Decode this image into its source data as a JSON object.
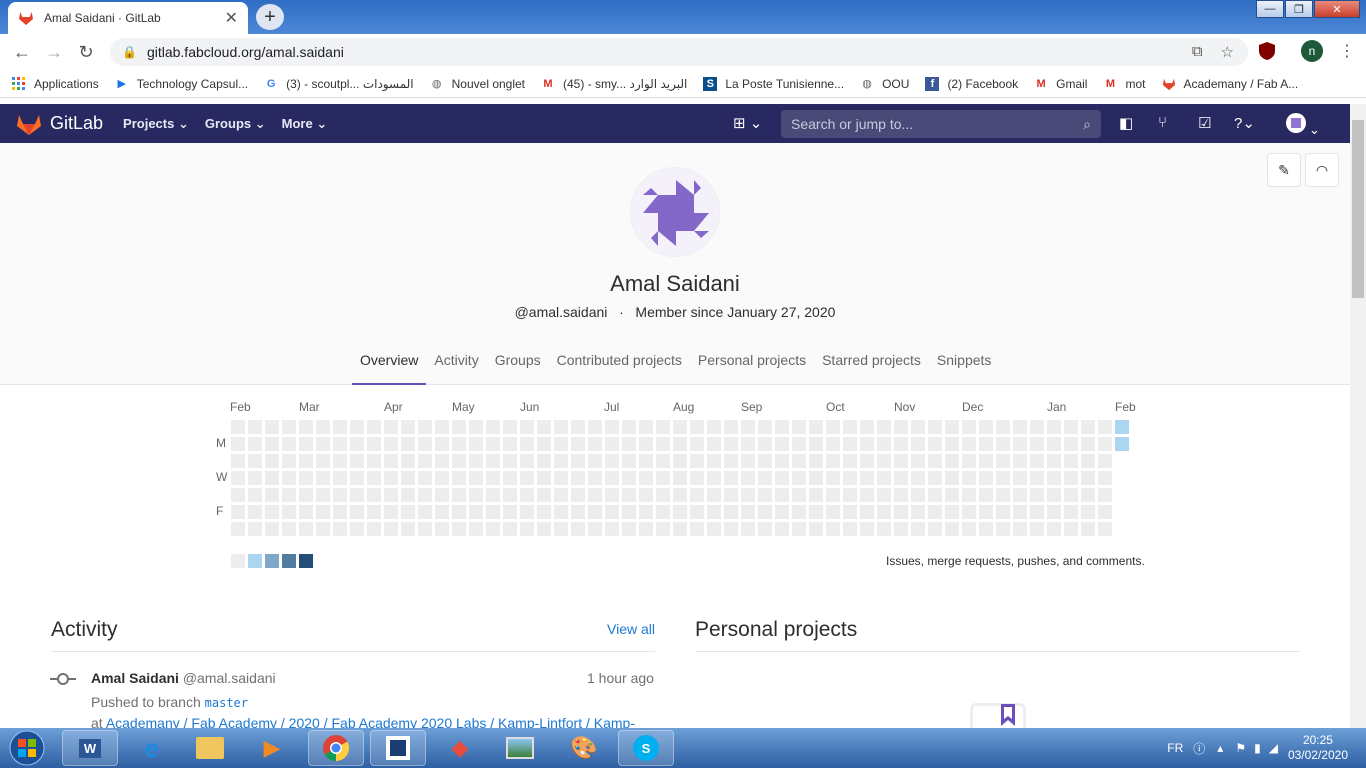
{
  "browser": {
    "tab_title": "Amal Saidani · GitLab",
    "url": "gitlab.fabcloud.org/amal.saidani",
    "profile_initial": "n",
    "bookmarks": [
      {
        "label": "Applications",
        "icon": "apps-grid-icon"
      },
      {
        "label": "Technology Capsul...",
        "icon": "play-icon"
      },
      {
        "label": "(3) - scoutpl... المسودات",
        "icon": "google-icon"
      },
      {
        "label": "Nouvel onglet",
        "icon": "globe-icon"
      },
      {
        "label": "(45) - smy... البريد الوارد",
        "icon": "gmail-icon"
      },
      {
        "label": "La Poste Tunisienne...",
        "icon": "s-icon"
      },
      {
        "label": "OOU",
        "icon": "globe-icon"
      },
      {
        "label": "(2) Facebook",
        "icon": "facebook-icon"
      },
      {
        "label": "Gmail",
        "icon": "gmail-icon"
      },
      {
        "label": "mot",
        "icon": "gmail-icon"
      },
      {
        "label": "Academany / Fab A...",
        "icon": "gitlab-icon"
      }
    ]
  },
  "gitlab": {
    "brand": "GitLab",
    "nav": [
      "Projects",
      "Groups",
      "More"
    ],
    "search_placeholder": "Search or jump to...",
    "accent": "#292961"
  },
  "profile": {
    "name": "Amal Saidani",
    "username": "@amal.saidani",
    "separator": "·",
    "member_since": "Member since January 27, 2020",
    "tabs": [
      "Overview",
      "Activity",
      "Groups",
      "Contributed projects",
      "Personal projects",
      "Starred projects",
      "Snippets"
    ],
    "active_tab": "Overview"
  },
  "calendar": {
    "months": [
      "Feb",
      "Mar",
      "Apr",
      "May",
      "Jun",
      "Jul",
      "Aug",
      "Sep",
      "Oct",
      "Nov",
      "Dec",
      "Jan",
      "Feb"
    ],
    "day_labels": [
      "M",
      "W",
      "F"
    ],
    "weeks": 52,
    "last_week_days": 2,
    "active_cells_last_week": [
      0,
      1
    ],
    "legend_colors": [
      "#ededed",
      "#acd5f2",
      "#7fa8c9",
      "#527ba0",
      "#254e77"
    ],
    "note": "Issues, merge requests, pushes, and comments."
  },
  "activity": {
    "title": "Activity",
    "view_all": "View all",
    "event": {
      "author": "Amal Saidani",
      "username": "@amal.saidani",
      "time": "1 hour ago",
      "action": "Pushed to branch",
      "branch": "master",
      "path_prefix": "at",
      "path": "Academany / Fab Academy / 2020 / Fab Academy 2020 Labs / Kamp-Lintfort / Kamp-"
    }
  },
  "personal_projects": {
    "title": "Personal projects"
  },
  "taskbar": {
    "language": "FR",
    "time": "20:25",
    "date": "03/02/2020"
  }
}
